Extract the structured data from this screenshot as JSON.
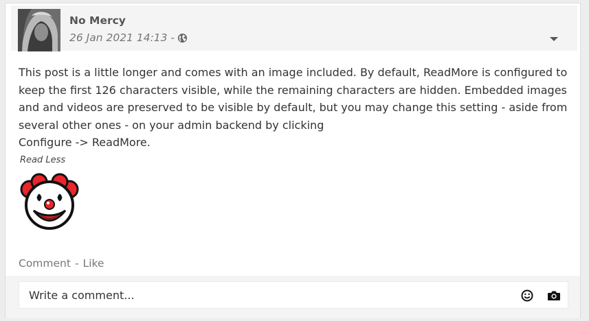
{
  "post": {
    "author": "No Mercy",
    "timestamp": "26 Jan 2021 14:13 -",
    "visibility_icon": "globe-icon",
    "menu_icon": "caret-down-icon",
    "body_lines": [
      "This post is a little longer and comes with an image included. By default, ReadMore is configured to",
      "keep the first 126 characters visible, while the remaining characters are hidden. Embedded images",
      "and and videos are preserved to be visible by default, but you may change this setting - aside from",
      "several other ones - on your admin backend by clicking",
      "Configure -> ReadMore."
    ],
    "read_less_label": "Read Less",
    "image_icon": "clown-face-icon"
  },
  "actions": {
    "comment_label": "Comment",
    "separator": "-",
    "like_label": "Like"
  },
  "comment_box": {
    "placeholder": "Write a comment...",
    "emoji_icon": "smiley-icon",
    "camera_icon": "camera-icon"
  },
  "colors": {
    "header_bg": "#f4f4f4",
    "text": "#333333",
    "muted": "#777777",
    "clown_red": "#e8262b",
    "clown_blue": "#1aa0e6"
  }
}
